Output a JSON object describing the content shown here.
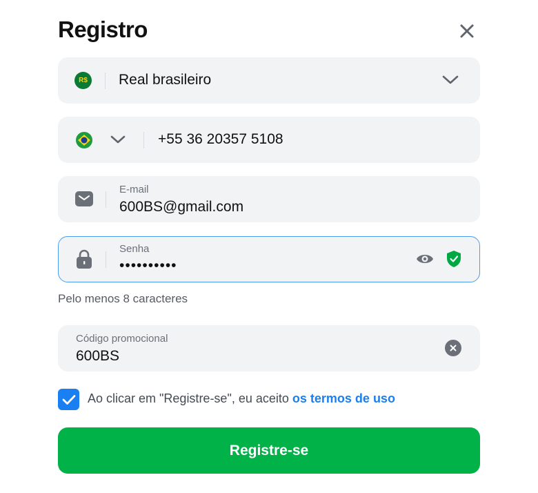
{
  "dialog": {
    "title": "Registro"
  },
  "currency": {
    "badge": "R$",
    "value": "Real brasileiro"
  },
  "phone": {
    "value": "+55 36 20357 5108"
  },
  "email": {
    "label": "E-mail",
    "value": "600BS@gmail.com"
  },
  "password": {
    "label": "Senha",
    "value": "••••••••••",
    "hint": "Pelo menos 8 caracteres"
  },
  "promo": {
    "label": "Código promocional",
    "value": "600BS"
  },
  "terms": {
    "text": "Ao clicar em \"Registre-se\", eu aceito ",
    "link": "os termos de uso",
    "checked": true
  },
  "submit": {
    "label": "Registre-se"
  },
  "colors": {
    "accent": "#1a7ff0",
    "submit": "#00b248",
    "shield": "#00a843",
    "field_bg": "#f2f3f5"
  },
  "icons": {
    "close": "close-icon",
    "currency": "currency-real-icon",
    "flag": "brazil-flag-icon",
    "chevron": "chevron-down-icon",
    "email": "envelope-icon",
    "password": "lock-icon",
    "visibility": "eye-icon",
    "strength": "shield-check-icon",
    "clear": "clear-icon",
    "check": "checkmark-icon"
  }
}
